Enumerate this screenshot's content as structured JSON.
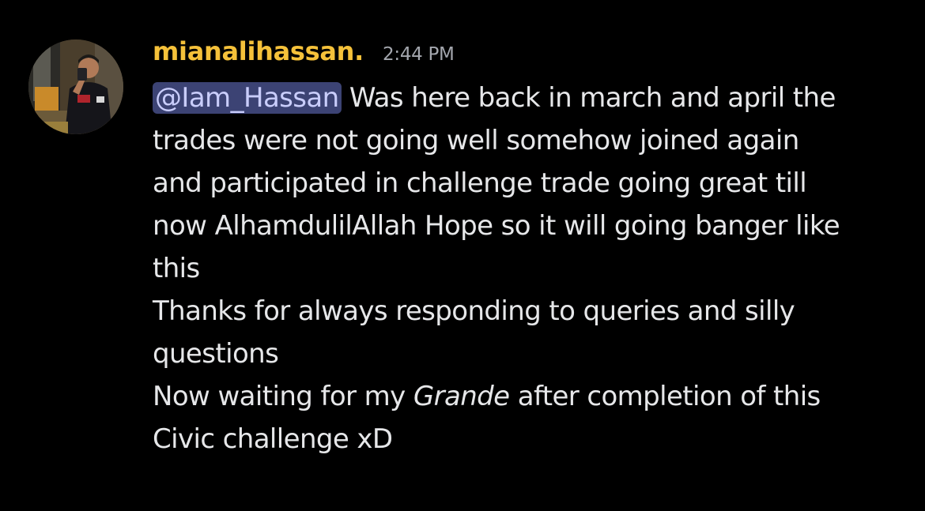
{
  "message": {
    "username": "mianalihassan.",
    "timestamp": "2:44 PM",
    "mention": "@Iam_Hassan",
    "lines": [
      "Was here back in march and april the",
      "trades were not going well somehow joined again",
      "and participated in challenge trade going great till",
      "now AlhamdulilAllah Hope so it will going banger like",
      "this",
      "Thanks for always responding to queries and silly",
      "questions",
      "Now waiting for my",
      "Grande",
      "after completion of this",
      "Civic challenge xD"
    ]
  },
  "colors": {
    "background": "#000000",
    "username": "#f5c13a",
    "timestamp": "#a3a6ad",
    "text": "#e6e7e9",
    "mention_bg": "#3c4374",
    "mention_text": "#c9cdfb"
  }
}
